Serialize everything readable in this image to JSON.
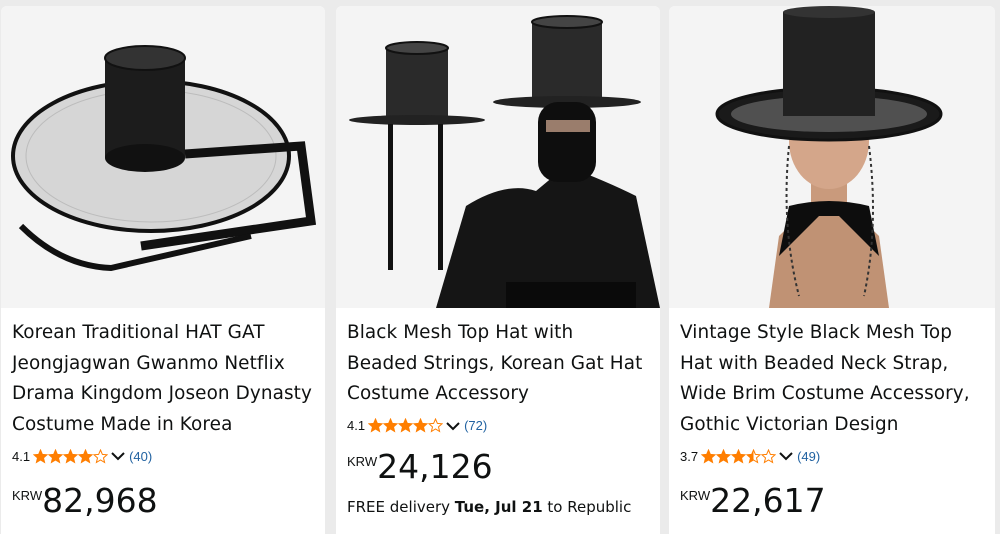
{
  "products": [
    {
      "title": "Korean Traditional HAT GAT Jeongjagwan Gwanmo Netflix Drama Kingdom Joseon Dynasty Costume Made in Korea",
      "rating": "4.1",
      "rating_value": 4.1,
      "review_count": "(40)",
      "currency": "KRW",
      "price": "82,968",
      "image_icon": "gat-hat-flat-icon"
    },
    {
      "title": "Black Mesh Top Hat with Beaded Strings, Korean Gat Hat Costume Accessory",
      "rating": "4.1",
      "rating_value": 4.1,
      "review_count": "(72)",
      "currency": "KRW",
      "price": "24,126",
      "delivery_prefix": "FREE delivery ",
      "delivery_date": "Tue, Jul 21",
      "delivery_suffix": " to Republic",
      "image_icon": "gat-hat-costume-icon"
    },
    {
      "title": "Vintage Style Black Mesh Top Hat with Beaded Neck Strap, Wide Brim Costume Accessory, Gothic Victorian Design",
      "rating": "3.7",
      "rating_value": 3.7,
      "review_count": "(49)",
      "currency": "KRW",
      "price": "22,617",
      "image_icon": "gat-hat-mannequin-icon"
    }
  ],
  "colors": {
    "star": "#ff7e00",
    "link": "#2162a1",
    "text": "#0f1111",
    "page_bg": "#ebebeb"
  }
}
